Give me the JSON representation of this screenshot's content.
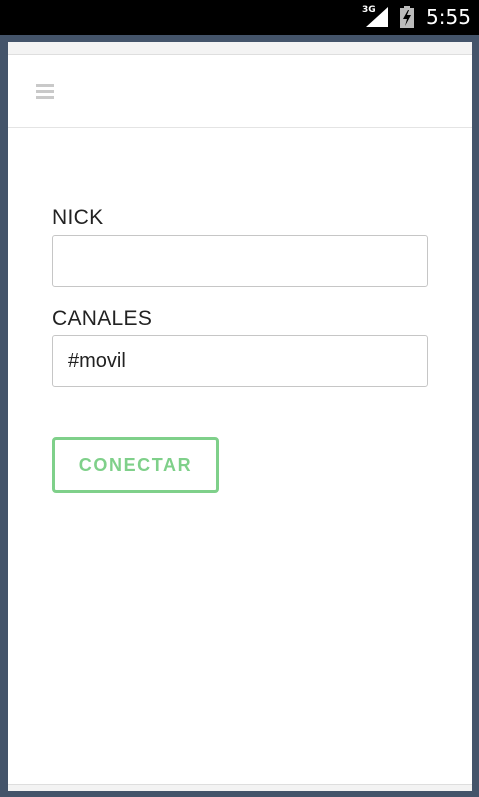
{
  "status_bar": {
    "network": "3G",
    "time": "5:55"
  },
  "header": {
    "menu_icon": "hamburger-menu-icon"
  },
  "form": {
    "nick": {
      "label": "NICK",
      "value": ""
    },
    "channels": {
      "label": "CANALES",
      "value": "#movil"
    },
    "connect_label": "CONECTAR"
  },
  "colors": {
    "accent": "#7fd08a",
    "frame": "#44546a"
  }
}
